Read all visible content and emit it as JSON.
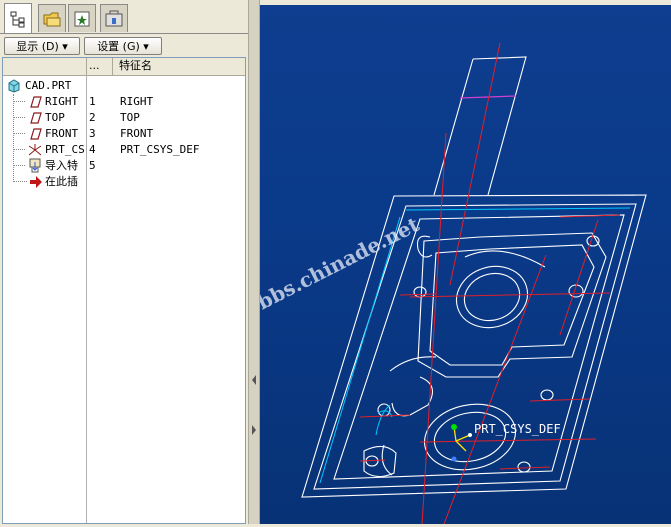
{
  "toolbar": {
    "show_label": "显示 (D) ▾",
    "settings_label": "设置 (G) ▾"
  },
  "columns": {
    "dots": "...",
    "feature_name": "特征名"
  },
  "tree": {
    "root": "CAD.PRT",
    "items": [
      {
        "label": "RIGHT",
        "icon": "datum-plane-icon"
      },
      {
        "label": "TOP",
        "icon": "datum-plane-icon"
      },
      {
        "label": "FRONT",
        "icon": "datum-plane-icon"
      },
      {
        "label": "PRT_CS",
        "icon": "coordinate-system-icon"
      },
      {
        "label": "导入特",
        "icon": "import-feature-icon"
      },
      {
        "label": "在此插",
        "icon": "insert-here-arrow-icon"
      }
    ]
  },
  "features": [
    {
      "num": "1",
      "name": "RIGHT"
    },
    {
      "num": "2",
      "name": "TOP"
    },
    {
      "num": "3",
      "name": "FRONT"
    },
    {
      "num": "4",
      "name": "PRT_CSYS_DEF"
    },
    {
      "num": "5",
      "name": ""
    }
  ],
  "viewport": {
    "csys_label": "PRT_CSYS_DEF",
    "watermark": "bbs.chinade.net"
  },
  "colors": {
    "background_top": "#0f3d8f",
    "background_bottom": "#083276",
    "geometry": "#ffffff",
    "datum_axis": "#e0202a",
    "highlight": "#00c8ff"
  }
}
